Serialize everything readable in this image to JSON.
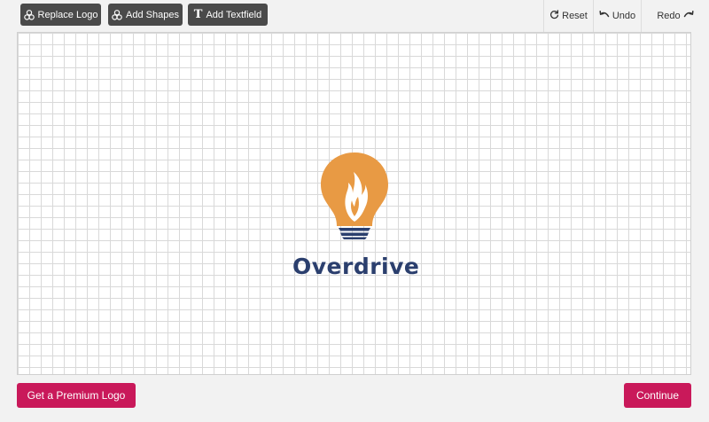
{
  "toolbar": {
    "replace_logo_label": "Replace Logo",
    "add_shapes_label": "Add Shapes",
    "add_textfield_label": "Add Textfield",
    "textfield_glyph": "T",
    "reset_label": "Reset",
    "undo_label": "Undo",
    "redo_label": "Redo"
  },
  "logo": {
    "name": "Overdrive",
    "text_color": "#2b3f6e",
    "bulb_color": "#e89a44",
    "base_color": "#2b3f6e"
  },
  "footer": {
    "premium_label": "Get a Premium Logo",
    "continue_label": "Continue"
  },
  "colors": {
    "toolbar_button": "#4a4a4a",
    "accent": "#c9195a"
  },
  "icons": {
    "replace_logo": "shapes-icon",
    "add_shapes": "shapes-icon",
    "add_textfield": "text-icon",
    "reset": "reset-icon",
    "undo": "undo-icon",
    "redo": "redo-icon"
  }
}
